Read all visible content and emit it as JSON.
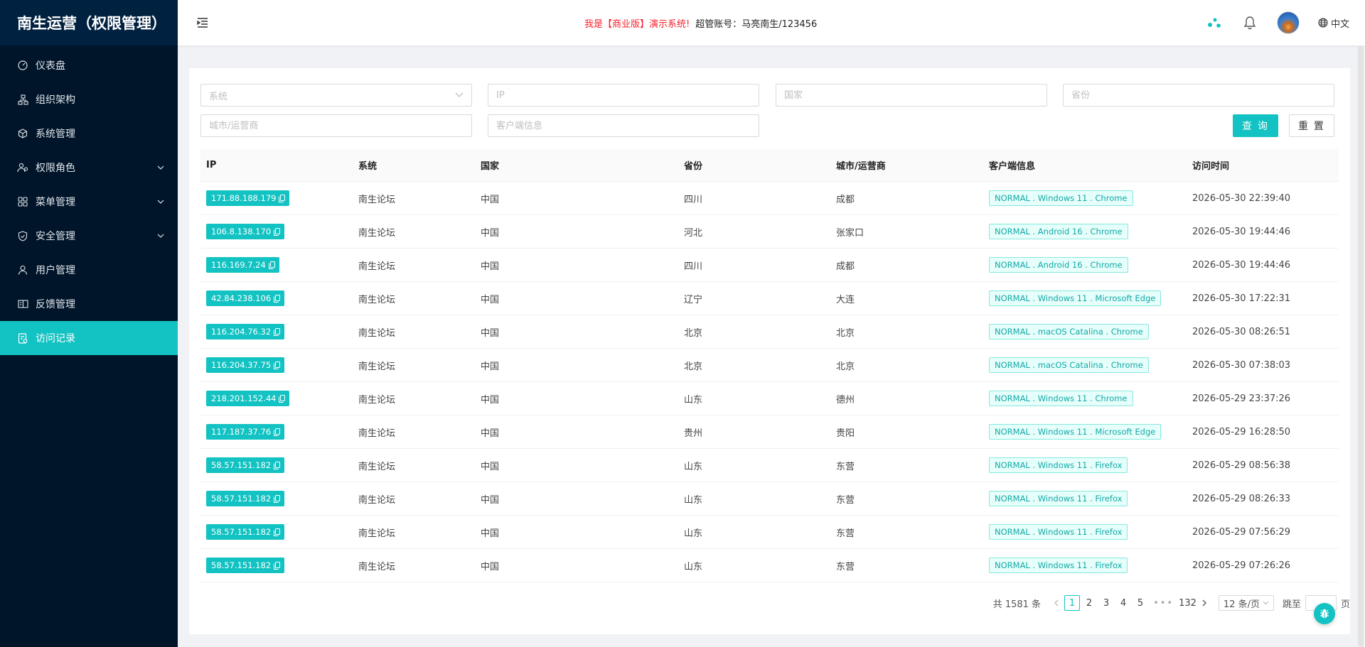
{
  "brand": {
    "title": "南生运营（权限管理）"
  },
  "sidebar": {
    "items": [
      {
        "label": "仪表盘",
        "icon": "dashboard-icon",
        "has_children": false,
        "active": false
      },
      {
        "label": "组织架构",
        "icon": "org-structure-icon",
        "has_children": false,
        "active": false
      },
      {
        "label": "系统管理",
        "icon": "cube-icon",
        "has_children": false,
        "active": false
      },
      {
        "label": "权限角色",
        "icon": "role-icon",
        "has_children": true,
        "active": false
      },
      {
        "label": "菜单管理",
        "icon": "grid-icon",
        "has_children": true,
        "active": false
      },
      {
        "label": "安全管理",
        "icon": "shield-icon",
        "has_children": true,
        "active": false
      },
      {
        "label": "用户管理",
        "icon": "user-icon",
        "has_children": false,
        "active": false
      },
      {
        "label": "反馈管理",
        "icon": "book-icon",
        "has_children": false,
        "active": false
      },
      {
        "label": "访问记录",
        "icon": "record-icon",
        "has_children": false,
        "active": true
      }
    ]
  },
  "header": {
    "notice_red": "我是【商业版】演示系统!",
    "notice_dark": "超管账号：马亮南生/123456",
    "lang_label": "中文"
  },
  "filters": {
    "system_placeholder": "系统",
    "ip_placeholder": "IP",
    "country_placeholder": "国家",
    "province_placeholder": "省份",
    "city_placeholder": "城市/运营商",
    "client_placeholder": "客户端信息",
    "query_label": "查 询",
    "reset_label": "重 置"
  },
  "table": {
    "columns": [
      "IP",
      "系统",
      "国家",
      "省份",
      "城市/运营商",
      "客户端信息",
      "访问时间"
    ],
    "rows": [
      {
        "ip": "171.88.188.179",
        "system": "南生论坛",
        "country": "中国",
        "province": "四川",
        "city": "成都",
        "client": "NORMAL . Windows 11 . Chrome",
        "time": "2026-05-30 22:39:40"
      },
      {
        "ip": "106.8.138.170",
        "system": "南生论坛",
        "country": "中国",
        "province": "河北",
        "city": "张家口",
        "client": "NORMAL . Android 16 . Chrome",
        "time": "2026-05-30 19:44:46"
      },
      {
        "ip": "116.169.7.24",
        "system": "南生论坛",
        "country": "中国",
        "province": "四川",
        "city": "成都",
        "client": "NORMAL . Android 16 . Chrome",
        "time": "2026-05-30 19:44:46"
      },
      {
        "ip": "42.84.238.106",
        "system": "南生论坛",
        "country": "中国",
        "province": "辽宁",
        "city": "大连",
        "client": "NORMAL . Windows 11 . Microsoft Edge",
        "time": "2026-05-30 17:22:31"
      },
      {
        "ip": "116.204.76.32",
        "system": "南生论坛",
        "country": "中国",
        "province": "北京",
        "city": "北京",
        "client": "NORMAL . macOS Catalina . Chrome",
        "time": "2026-05-30 08:26:51"
      },
      {
        "ip": "116.204.37.75",
        "system": "南生论坛",
        "country": "中国",
        "province": "北京",
        "city": "北京",
        "client": "NORMAL . macOS Catalina . Chrome",
        "time": "2026-05-30 07:38:03"
      },
      {
        "ip": "218.201.152.44",
        "system": "南生论坛",
        "country": "中国",
        "province": "山东",
        "city": "德州",
        "client": "NORMAL . Windows 11 . Chrome",
        "time": "2026-05-29 23:37:26"
      },
      {
        "ip": "117.187.37.76",
        "system": "南生论坛",
        "country": "中国",
        "province": "贵州",
        "city": "贵阳",
        "client": "NORMAL . Windows 11 . Microsoft Edge",
        "time": "2026-05-29 16:28:50"
      },
      {
        "ip": "58.57.151.182",
        "system": "南生论坛",
        "country": "中国",
        "province": "山东",
        "city": "东营",
        "client": "NORMAL . Windows 11 . Firefox",
        "time": "2026-05-29 08:56:38"
      },
      {
        "ip": "58.57.151.182",
        "system": "南生论坛",
        "country": "中国",
        "province": "山东",
        "city": "东营",
        "client": "NORMAL . Windows 11 . Firefox",
        "time": "2026-05-29 08:26:33"
      },
      {
        "ip": "58.57.151.182",
        "system": "南生论坛",
        "country": "中国",
        "province": "山东",
        "city": "东营",
        "client": "NORMAL . Windows 11 . Firefox",
        "time": "2026-05-29 07:56:29"
      },
      {
        "ip": "58.57.151.182",
        "system": "南生论坛",
        "country": "中国",
        "province": "山东",
        "city": "东营",
        "client": "NORMAL . Windows 11 . Firefox",
        "time": "2026-05-29 07:26:26"
      }
    ]
  },
  "pagination": {
    "total_text": "共 1581 条",
    "pages": [
      "1",
      "2",
      "3",
      "4",
      "5"
    ],
    "current": "1",
    "ellipsis": "•••",
    "last_page": "132",
    "page_size_label": "12 条/页",
    "jump_label": "跳至",
    "page_suffix": "页"
  },
  "colors": {
    "accent": "#13c2c2",
    "sidebar_bg": "#001529",
    "brand_bg": "#002140",
    "notice_red": "#f5222d"
  }
}
